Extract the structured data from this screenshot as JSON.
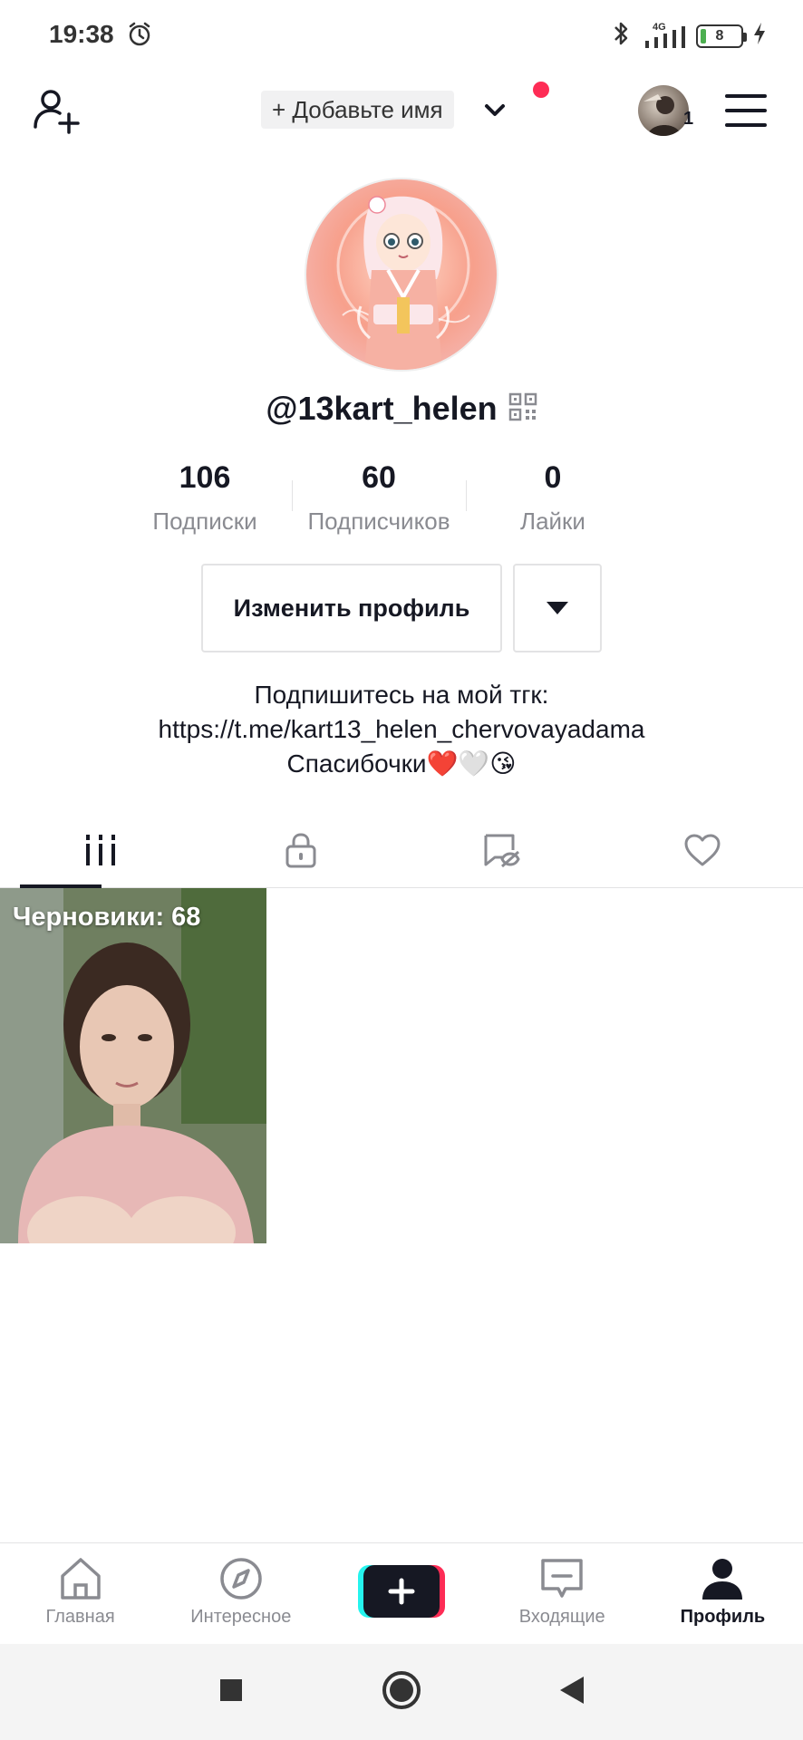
{
  "status_bar": {
    "time": "19:38",
    "network": "4G",
    "battery": "8"
  },
  "header": {
    "add_name_label": "+ Добавьте имя",
    "avatar_count": "1"
  },
  "profile": {
    "username": "@13kart_helen",
    "stats": [
      {
        "value": "106",
        "label": "Подписки"
      },
      {
        "value": "60",
        "label": "Подписчиков"
      },
      {
        "value": "0",
        "label": "Лайки"
      }
    ],
    "edit_button": "Изменить профиль",
    "bio_lines": [
      "Подпишитесь на мой тгк:",
      "https://t.me/kart13_helen_chervovayadama",
      "Спасибочки❤️🤍😘"
    ]
  },
  "tabs": [
    {
      "icon": "videos-grid-icon",
      "active": true
    },
    {
      "icon": "lock-icon",
      "active": false
    },
    {
      "icon": "reposts-icon",
      "active": false
    },
    {
      "icon": "heart-icon",
      "active": false
    }
  ],
  "grid": {
    "drafts_label": "Черновики: 68"
  },
  "bottom_nav": {
    "items": [
      {
        "label": "Главная",
        "icon": "home-icon"
      },
      {
        "label": "Интересное",
        "icon": "compass-icon"
      },
      {
        "label": "",
        "icon": "plus-icon"
      },
      {
        "label": "Входящие",
        "icon": "inbox-icon"
      },
      {
        "label": "Профиль",
        "icon": "profile-icon"
      }
    ],
    "active_index": 4
  },
  "colors": {
    "accent_red": "#fe2c55",
    "accent_cyan": "#25f4ee",
    "text_primary": "#161823",
    "text_secondary": "#8a8b91"
  }
}
